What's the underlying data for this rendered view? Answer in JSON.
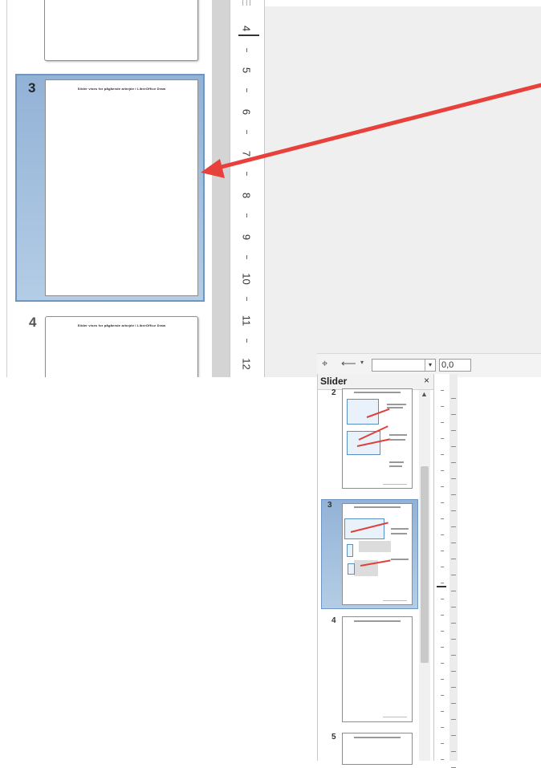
{
  "top": {
    "slides": [
      {
        "number": "3",
        "title": "Slider vises for pågående arbejde i LibreOffice Draw"
      },
      {
        "number": "4",
        "title": "Slider vises for pågående arbejde i LibreOffice Draw"
      }
    ],
    "ruler": {
      "labels": [
        "4",
        "5",
        "6",
        "7",
        "8",
        "9",
        "10",
        "11",
        "12"
      ]
    },
    "toolbar": {
      "value": "0,0"
    }
  },
  "bottom": {
    "panel_title": "Slider",
    "close": "×",
    "slides": [
      {
        "number": "2"
      },
      {
        "number": "3"
      },
      {
        "number": "4"
      },
      {
        "number": "5"
      }
    ]
  },
  "colors": {
    "selection": "#92b2d6",
    "arrow": "#e8403a"
  },
  "icons": [
    "close-icon",
    "scroll-up-icon",
    "pointer-icon",
    "arrow-line-icon",
    "dropdown-arrow-icon"
  ]
}
